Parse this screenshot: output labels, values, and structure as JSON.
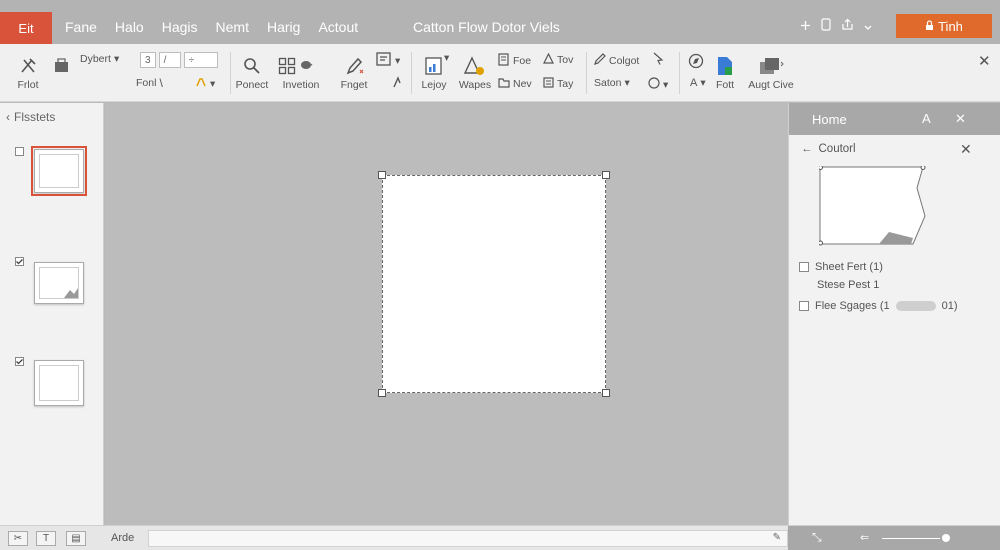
{
  "menubar": {
    "app_tab": "Eit",
    "items": [
      "Fane",
      "Halo",
      "Hagis",
      "Nemt",
      "Harig",
      "Actout"
    ],
    "title": "Catton Flow Dotor Viels",
    "share_label": "Tinh"
  },
  "ribbon": {
    "groups": [
      {
        "label": "Frlot",
        "icon": "tools-icon"
      },
      {
        "label": "Dybert",
        "icon": "paint-bucket-icon"
      },
      {
        "label": "Fonl",
        "icon": "font-icon"
      },
      {
        "label": "Ponect",
        "icon": "search-icon"
      },
      {
        "label": "Invetion",
        "icon": "layout-icon"
      },
      {
        "label": "Fnget",
        "icon": "pen-icon"
      },
      {
        "label": "Lejoy",
        "icon": "chart-icon"
      },
      {
        "label": "Wapes",
        "icon": "shape-icon"
      },
      {
        "label": "Fott",
        "icon": "document-icon"
      },
      {
        "label": "Augt Cive",
        "icon": "window-icon"
      }
    ],
    "small_items": {
      "font_field_1": "3",
      "font_field_2": "/",
      "font_field_3": "÷",
      "for_label": "Foe",
      "tov_label": "Tov",
      "nev_label": "Nev",
      "tay_label": "Tay",
      "colgot_label": "Colgot",
      "saton_label": "Saton"
    }
  },
  "left_panel": {
    "title": "Flsstets",
    "thumbnails": [
      {
        "checked": false,
        "selected": true
      },
      {
        "checked": true,
        "selected": false
      },
      {
        "checked": true,
        "selected": false
      }
    ]
  },
  "right_pane": {
    "title": "Home",
    "section": "Coutorl",
    "options": [
      {
        "label": "Sheet Fert (1)",
        "checked": false
      },
      {
        "label": "Stese Pest 1",
        "checked": false,
        "plain": true
      },
      {
        "label": "Flee Sgages (1",
        "suffix": "01)",
        "checked": false
      }
    ]
  },
  "status_bar": {
    "label": "Arde"
  }
}
